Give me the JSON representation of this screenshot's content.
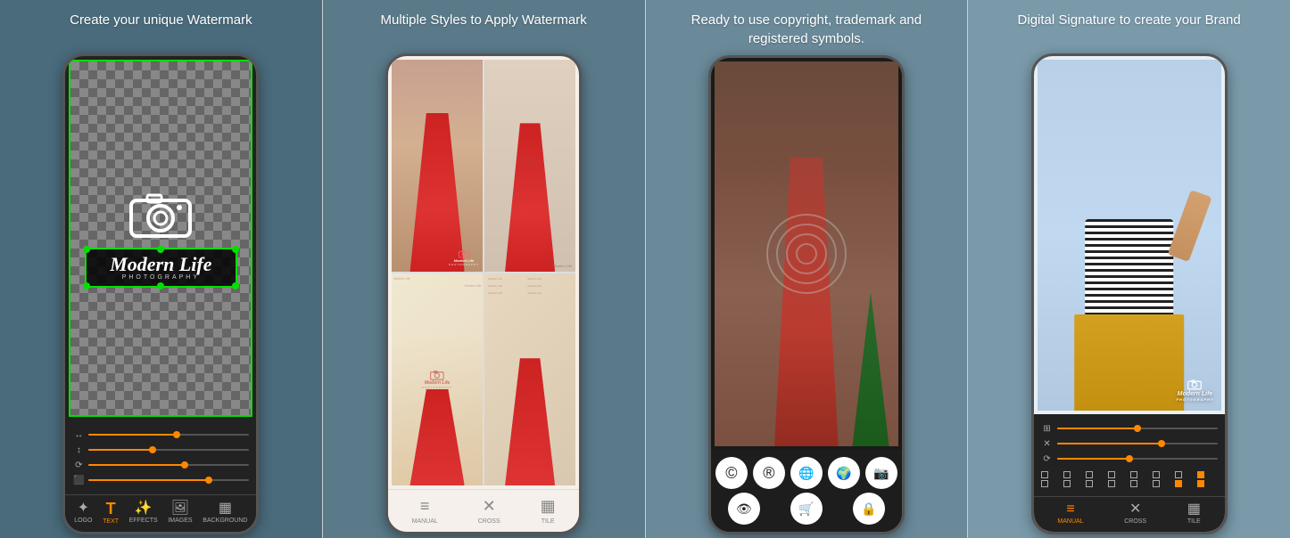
{
  "panels": [
    {
      "id": "panel-1",
      "title": "Create your\nunique Watermark",
      "watermark": {
        "main_text": "Modern Life",
        "sub_text": "PHOTOGRAPHY"
      },
      "controls": [
        {
          "icon": "↔",
          "fill_pct": 55
        },
        {
          "icon": "↕",
          "fill_pct": 40
        },
        {
          "icon": "⟳",
          "fill_pct": 60
        },
        {
          "icon": "⬛",
          "fill_pct": 75
        }
      ],
      "toolbar": [
        {
          "label": "LOGO",
          "icon": "✦",
          "active": false
        },
        {
          "label": "TEXT",
          "icon": "T",
          "active": true
        },
        {
          "label": "EFFECTS",
          "icon": "✨",
          "active": false
        },
        {
          "label": "IMAGES",
          "icon": "🖼",
          "active": false
        },
        {
          "label": "BACKGROUND",
          "icon": "▦",
          "active": false
        }
      ]
    },
    {
      "id": "panel-2",
      "title": "Multiple Styles\nto Apply Watermark",
      "toolbar": [
        {
          "label": "MANUAL",
          "icon": "≡",
          "active": false
        },
        {
          "label": "CROSS",
          "icon": "✕",
          "active": false
        },
        {
          "label": "TILE",
          "icon": "▦",
          "active": false
        }
      ],
      "watermark_text": "Modern Life\nPHOTOGRAPHY"
    },
    {
      "id": "panel-3",
      "title": "Ready to use copyright,\ntrademark and registered symbols.",
      "symbols": [
        "©",
        "®",
        "🌐",
        "🌍",
        "📷",
        "👁",
        "🛒",
        "🔒"
      ]
    },
    {
      "id": "panel-4",
      "title": "Digital Signature\nto create your Brand",
      "watermark": {
        "main_text": "Modern Life",
        "sub_text": "PHOTOGRAPHY"
      },
      "toolbar": [
        {
          "label": "MANUAL",
          "icon": "≡",
          "active": true
        },
        {
          "label": "CROSS",
          "icon": "✕",
          "active": false
        },
        {
          "label": "TILE",
          "icon": "▦",
          "active": false
        }
      ],
      "controls": [
        {
          "icon": "⊞",
          "fill_pct": 50
        },
        {
          "icon": "✕",
          "fill_pct": 65
        },
        {
          "icon": "⟳",
          "fill_pct": 45
        }
      ]
    }
  ],
  "brand": {
    "accent_color": "#ff8800",
    "green_color": "#00e000",
    "white": "#ffffff"
  }
}
